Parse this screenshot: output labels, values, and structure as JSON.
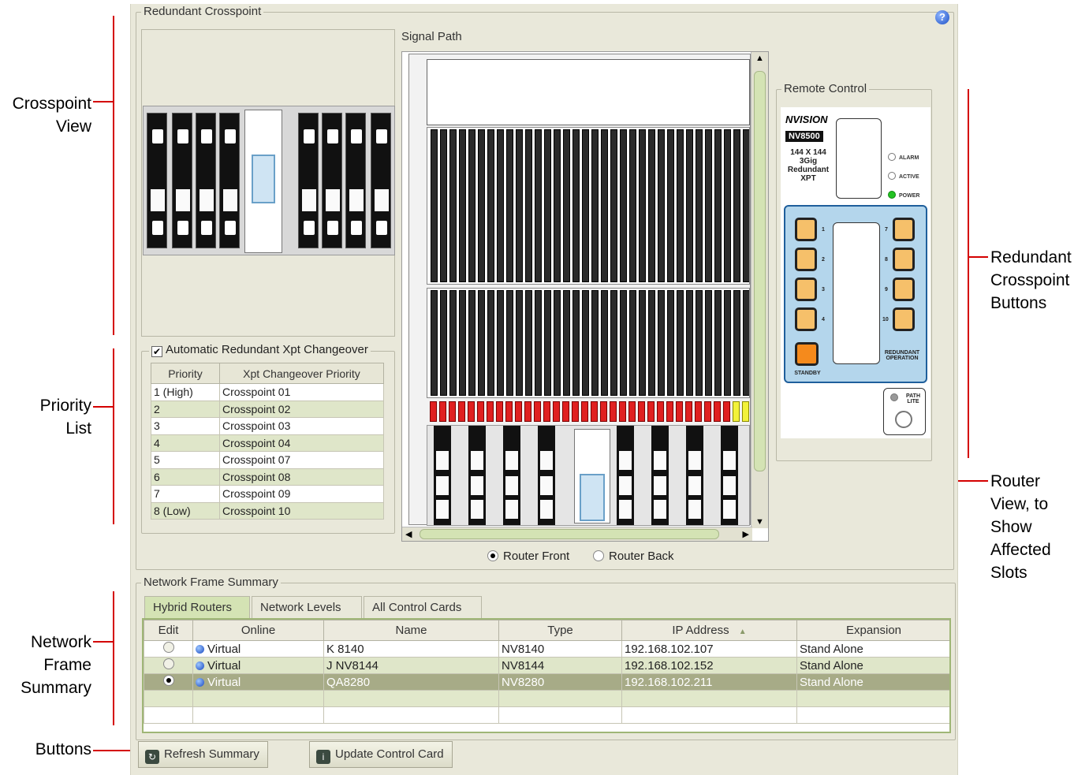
{
  "callouts": {
    "crosspoint_view": "Crosspoint\nView",
    "priority_list": "Priority\nList",
    "network_frame_summary": "Network\nFrame\nSummary",
    "buttons": "Buttons",
    "redundant_crosspoint_buttons": "Redundant\nCrosspoint\nButtons",
    "router_view": "Router\nView, to\nShow\nAffected\nSlots",
    "line_color": "#d40000"
  },
  "redundant_crosspoint": {
    "title": "Redundant Crosspoint",
    "help_icon": "question-icon",
    "auto_changeover": {
      "label": "Automatic Redundant Xpt Changeover",
      "checked": true
    },
    "priority_table": {
      "columns": [
        "Priority",
        "Xpt Changeover Priority"
      ],
      "rows": [
        [
          "1 (High)",
          "Crosspoint 01"
        ],
        [
          "2",
          "Crosspoint 02"
        ],
        [
          "3",
          "Crosspoint 03"
        ],
        [
          "4",
          "Crosspoint 04"
        ],
        [
          "5",
          "Crosspoint 07"
        ],
        [
          "6",
          "Crosspoint 08"
        ],
        [
          "7",
          "Crosspoint 09"
        ],
        [
          "8 (Low)",
          "Crosspoint 10"
        ]
      ]
    },
    "signal_path": {
      "title": "Signal Path",
      "view_options": [
        "Router Front",
        "Router Back"
      ],
      "selected_view": "Router Front"
    },
    "remote_control": {
      "title": "Remote Control",
      "logo": "NVISION",
      "model": "NV8500",
      "description": "144 X 144\n3Gig\nRedundant\nXPT",
      "leds": [
        "ALARM",
        "ACTIVE",
        "POWER"
      ],
      "left_buttons": [
        "1",
        "2",
        "3",
        "4"
      ],
      "right_buttons": [
        "7",
        "8",
        "9",
        "10"
      ],
      "standby_label": "STANDBY",
      "operation_label": "REDUNDANT\nOPERATION",
      "path_lite_label": "PATH\nLITE"
    }
  },
  "network_frame_summary": {
    "title": "Network Frame Summary",
    "tabs": [
      "Hybrid Routers",
      "Network Levels",
      "All Control Cards"
    ],
    "active_tab": "Hybrid Routers",
    "columns": [
      "Edit",
      "Online",
      "Name",
      "Type",
      "IP Address",
      "Expansion"
    ],
    "sort_indicator": "▲",
    "rows": [
      {
        "online": "Virtual",
        "name": "K 8140",
        "type": "NV8140",
        "ip": "192.168.102.107",
        "expansion": "Stand Alone",
        "selected": false
      },
      {
        "online": "Virtual",
        "name": "J NV8144",
        "type": "NV8144",
        "ip": "192.168.102.152",
        "expansion": "Stand Alone",
        "selected": false
      },
      {
        "online": "Virtual",
        "name": "QA8280",
        "type": "NV8280",
        "ip": "192.168.102.211",
        "expansion": "Stand Alone",
        "selected": true
      }
    ]
  },
  "buttons": {
    "refresh": "Refresh Summary",
    "update": "Update Control Card"
  }
}
